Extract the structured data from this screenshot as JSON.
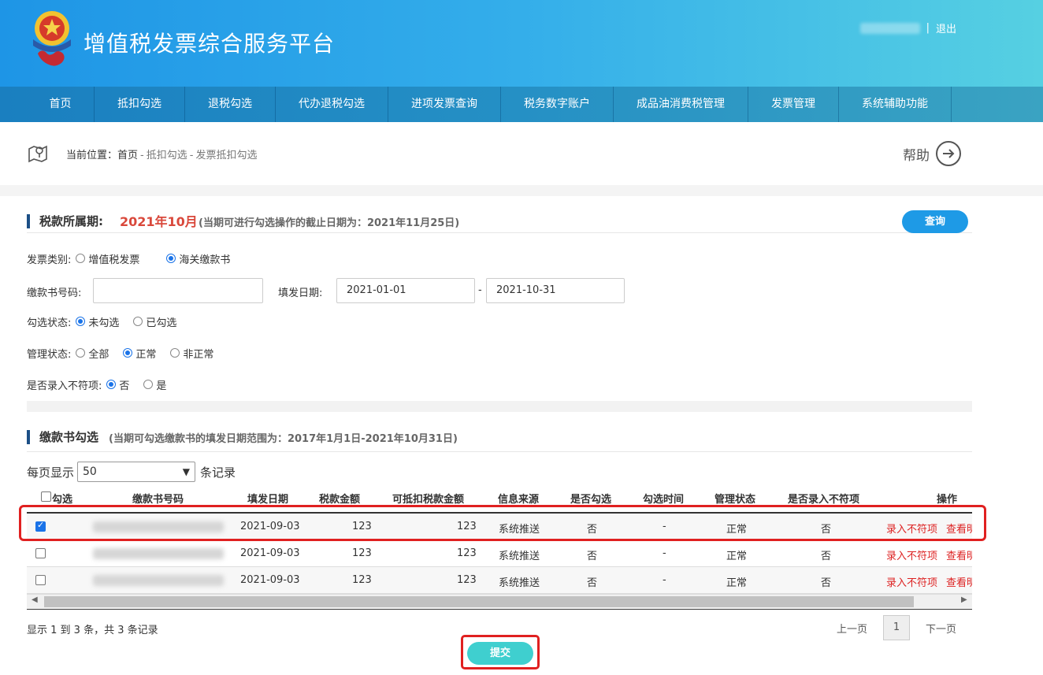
{
  "header": {
    "title": "增值税发票综合服务平台",
    "separator": "|",
    "logout": "退出"
  },
  "nav": {
    "items": [
      "首页",
      "抵扣勾选",
      "退税勾选",
      "代办退税勾选",
      "进项发票查询",
      "税务数字账户",
      "成品油消费税管理",
      "发票管理",
      "系统辅助功能"
    ]
  },
  "breadcrumb": {
    "prefix": "当前位置：",
    "home": "首页",
    "sep": "-",
    "level1": "抵扣勾选",
    "level2": "发票抵扣勾选",
    "help": "帮助"
  },
  "period": {
    "label": "税款所属期:",
    "value": "2021年10月",
    "note": "(当期可进行勾选操作的截止日期为：2021年11月25日)",
    "query_button": "查询"
  },
  "form": {
    "invoice_type": {
      "label": "发票类别:",
      "options": [
        "增值税发票",
        "海关缴款书"
      ],
      "selected": 1
    },
    "code": {
      "label": "缴款书号码:",
      "value": ""
    },
    "date": {
      "label": "填发日期:",
      "from": "2021-01-01",
      "dash": "-",
      "to": "2021-10-31"
    },
    "check_status": {
      "label": "勾选状态:",
      "options": [
        "未勾选",
        "已勾选"
      ],
      "selected": 0
    },
    "manage_status": {
      "label": "管理状态:",
      "options": [
        "全部",
        "正常",
        "非正常"
      ],
      "selected": 1
    },
    "mismatch": {
      "label": "是否录入不符项:",
      "options": [
        "否",
        "是"
      ],
      "selected": 0
    }
  },
  "list_section": {
    "title": "缴款书勾选",
    "note": "(当期可勾选缴款书的填发日期范围为：2017年1月1日-2021年10月31日)"
  },
  "perpage": {
    "prefix": "每页显示",
    "value": "50",
    "suffix": "条记录"
  },
  "table": {
    "columns": [
      "勾选",
      "缴款书号码",
      "填发日期",
      "税款金额",
      "可抵扣税款金额",
      "信息来源",
      "是否勾选",
      "勾选时间",
      "管理状态",
      "是否录入不符项",
      "操作"
    ],
    "rows": [
      {
        "checked": true,
        "date": "2021-09-03",
        "tax": "123",
        "deductible": "123",
        "source": "系统推送",
        "selected": "否",
        "time": "-",
        "status": "正常",
        "mismatch": "否",
        "action1": "录入不符项",
        "action2": "查看明"
      },
      {
        "checked": false,
        "date": "2021-09-03",
        "tax": "123",
        "deductible": "123",
        "source": "系统推送",
        "selected": "否",
        "time": "-",
        "status": "正常",
        "mismatch": "否",
        "action1": "录入不符项",
        "action2": "查看明"
      },
      {
        "checked": false,
        "date": "2021-09-03",
        "tax": "123",
        "deductible": "123",
        "source": "系统推送",
        "selected": "否",
        "time": "-",
        "status": "正常",
        "mismatch": "否",
        "action1": "录入不符项",
        "action2": "查看明"
      }
    ]
  },
  "footer": {
    "summary": "显示 1 到 3 条，共 3 条记录",
    "prev": "上一页",
    "page": "1",
    "next": "下一页",
    "submit": "提交"
  }
}
